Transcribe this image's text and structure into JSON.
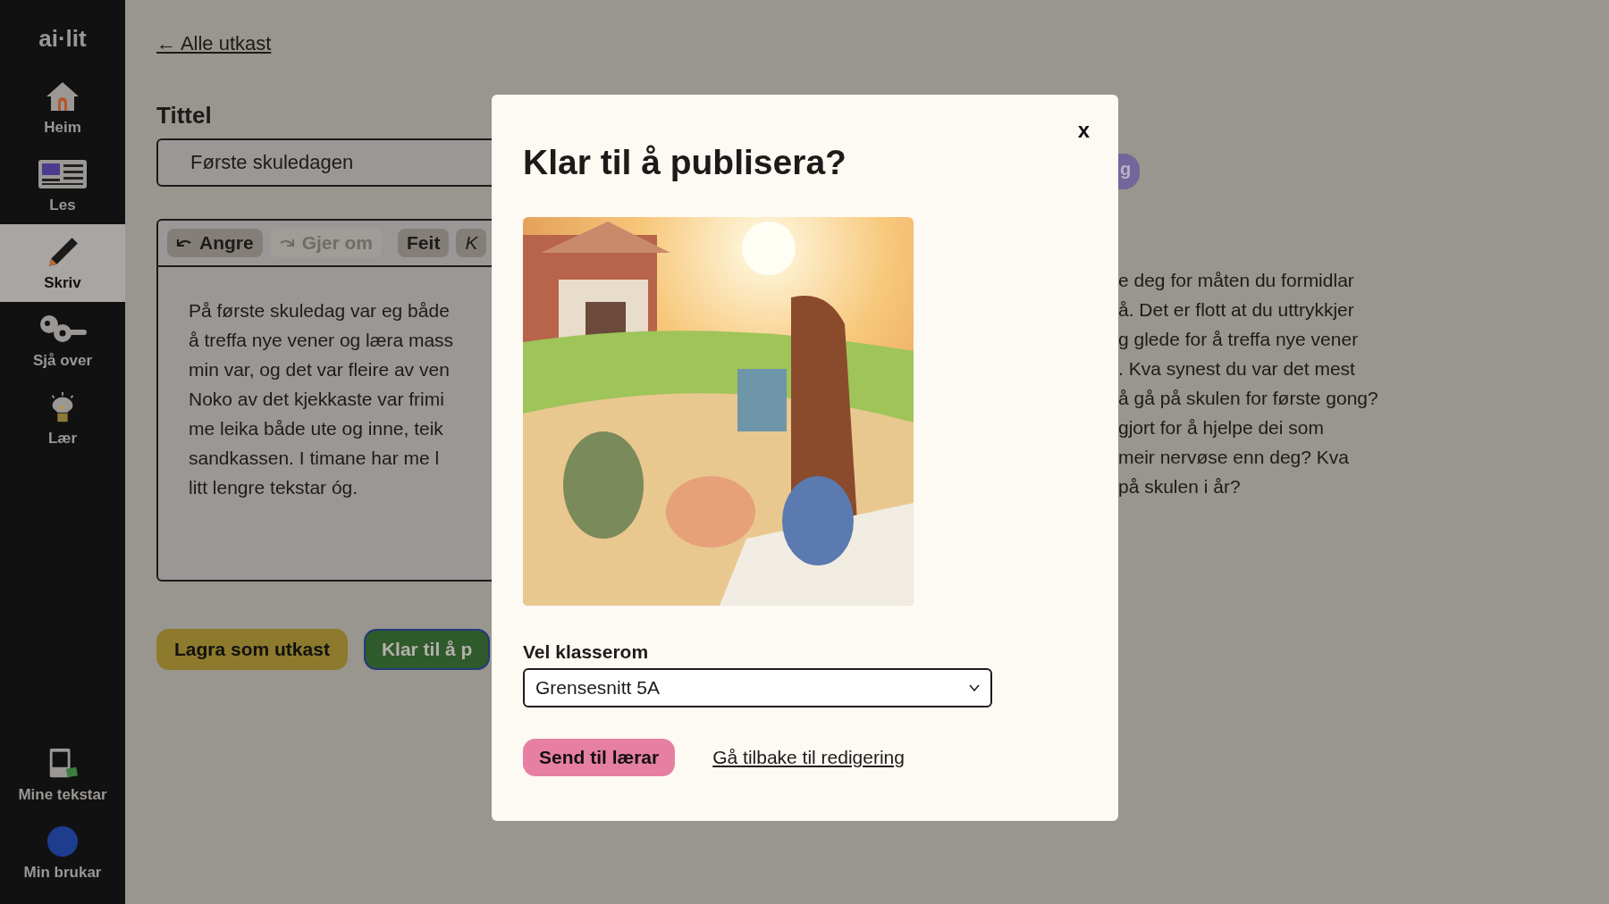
{
  "sidebar": {
    "logo": "ai·lit",
    "items": [
      {
        "kind": "home",
        "label": "Heim",
        "selected": false
      },
      {
        "kind": "read",
        "label": "Les",
        "selected": false
      },
      {
        "kind": "write",
        "label": "Skriv",
        "selected": true
      },
      {
        "kind": "review",
        "label": "Sjå over",
        "selected": false
      },
      {
        "kind": "learn",
        "label": "Lær",
        "selected": false
      }
    ],
    "bottom_items": [
      {
        "kind": "texts",
        "label": "Mine tekstar"
      },
      {
        "kind": "user",
        "label": "Min brukar"
      }
    ]
  },
  "back_link": "← Alle utkast",
  "title_field": {
    "label": "Tittel",
    "value": "Første skuledagen"
  },
  "editor": {
    "tools": [
      {
        "kind": "undo",
        "label": "Angre",
        "disabled": false
      },
      {
        "kind": "redo",
        "label": "Gjer om",
        "disabled": true
      },
      {
        "kind": "bold",
        "label": "Feit",
        "disabled": false
      },
      {
        "kind": "italic",
        "label": "K",
        "disabled": false
      }
    ],
    "lines": [
      "På første skuledag var eg både",
      "å treffa nye vener og læra mass",
      "min var, og det var fleire av ven",
      "Noko av det kjekkaste var frimi",
      "me leika både ute og inne, teik",
      "sandkassen. I timane har me l",
      "litt lengre tekstar óg."
    ]
  },
  "actions": [
    {
      "kind": "draft",
      "label": "Lagra som utkast"
    },
    {
      "kind": "publish",
      "label": "Klar til å p"
    }
  ],
  "feedback": {
    "badge": "g",
    "lines": [
      "e deg for måten du formidlar",
      "å. Det er flott at du uttrykkjer",
      "g glede for å treffa nye vener",
      ". Kva synest du var det mest",
      "å gå på skulen for første gong?",
      "gjort for å hjelpe dei som",
      "meir nervøse enn deg? Kva",
      "på skulen i år?"
    ]
  },
  "modal": {
    "close": "x",
    "title": "Klar til å publisera?",
    "classroom": {
      "label": "Vel klasserom",
      "value": "Grensesnitt 5A"
    },
    "submit": "Send til lærar",
    "back_link": "Gå tilbake til redigering"
  }
}
